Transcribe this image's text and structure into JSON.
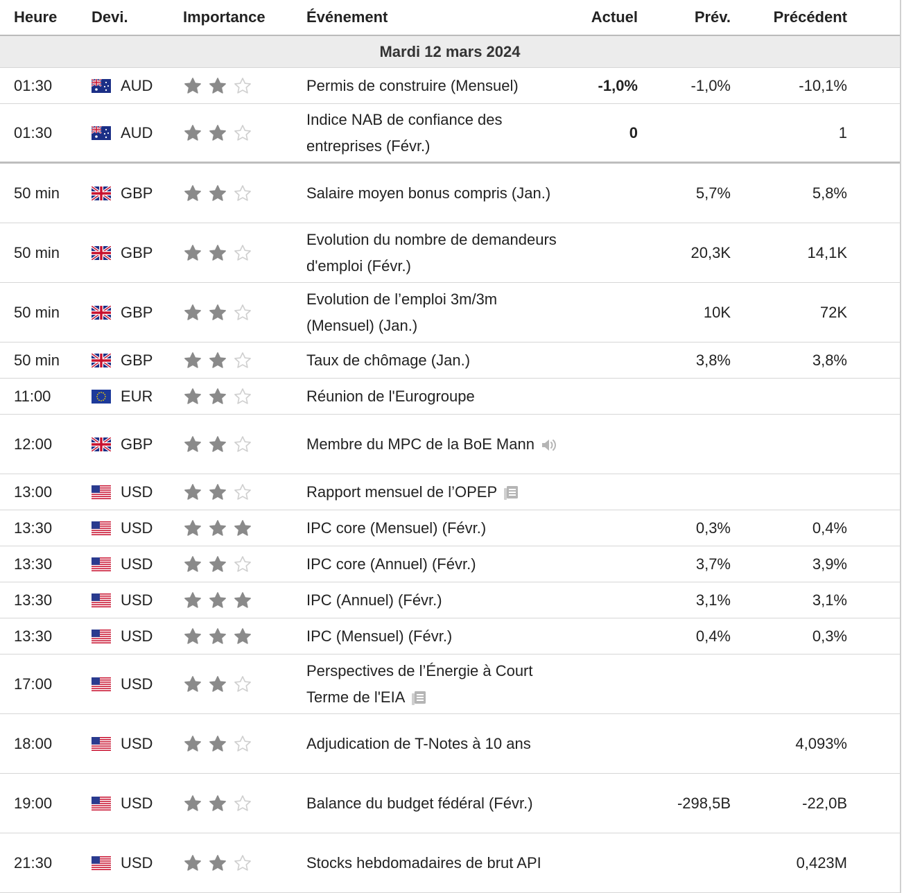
{
  "header": {
    "time": "Heure",
    "currency": "Devi.",
    "importance": "Importance",
    "event": "Événement",
    "actual": "Actuel",
    "forecast": "Prév.",
    "previous": "Précédent"
  },
  "date_label": "Mardi 12 mars 2024",
  "colors": {
    "star_filled": "#8a8a8a",
    "star_empty": "#cfcfcf",
    "header_border": "#bbbbbb",
    "date_bg": "#ececec"
  },
  "rows": [
    {
      "time": "01:30",
      "flag": "AU",
      "currency": "AUD",
      "stars": 2,
      "event": "Permis de construire (Mensuel)",
      "icon": "",
      "actual": "-1,0%",
      "forecast": "-1,0%",
      "previous": "-10,1%"
    },
    {
      "time": "01:30",
      "flag": "AU",
      "currency": "AUD",
      "stars": 2,
      "event": "Indice NAB de confiance des entreprises (Févr.)",
      "icon": "",
      "actual": "0",
      "forecast": "",
      "previous": "1"
    },
    {
      "time": "50 min",
      "flag": "GB",
      "currency": "GBP",
      "stars": 2,
      "event": "Salaire moyen bonus compris (Jan.)",
      "icon": "",
      "actual": "",
      "forecast": "5,7%",
      "previous": "5,8%"
    },
    {
      "time": "50 min",
      "flag": "GB",
      "currency": "GBP",
      "stars": 2,
      "event": "Evolution du nombre de demandeurs d'emploi (Févr.)",
      "icon": "",
      "actual": "",
      "forecast": "20,3K",
      "previous": "14,1K"
    },
    {
      "time": "50 min",
      "flag": "GB",
      "currency": "GBP",
      "stars": 2,
      "event": "Evolution de l’emploi 3m/3m (Mensuel) (Jan.)",
      "icon": "",
      "actual": "",
      "forecast": "10K",
      "previous": "72K"
    },
    {
      "time": "50 min",
      "flag": "GB",
      "currency": "GBP",
      "stars": 2,
      "event": "Taux de chômage (Jan.)",
      "icon": "",
      "actual": "",
      "forecast": "3,8%",
      "previous": "3,8%"
    },
    {
      "time": "11:00",
      "flag": "EU",
      "currency": "EUR",
      "stars": 2,
      "event": "Réunion de l'Eurogroupe",
      "icon": "",
      "actual": "",
      "forecast": "",
      "previous": ""
    },
    {
      "time": "12:00",
      "flag": "GB",
      "currency": "GBP",
      "stars": 2,
      "event": "Membre du MPC de la BoE Mann",
      "icon": "speaker-icon",
      "actual": "",
      "forecast": "",
      "previous": ""
    },
    {
      "time": "13:00",
      "flag": "US",
      "currency": "USD",
      "stars": 2,
      "event": "Rapport mensuel de l’OPEP",
      "icon": "report-icon",
      "actual": "",
      "forecast": "",
      "previous": ""
    },
    {
      "time": "13:30",
      "flag": "US",
      "currency": "USD",
      "stars": 3,
      "event": "IPC core (Mensuel) (Févr.)",
      "icon": "",
      "actual": "",
      "forecast": "0,3%",
      "previous": "0,4%"
    },
    {
      "time": "13:30",
      "flag": "US",
      "currency": "USD",
      "stars": 2,
      "event": "IPC core (Annuel) (Févr.)",
      "icon": "",
      "actual": "",
      "forecast": "3,7%",
      "previous": "3,9%"
    },
    {
      "time": "13:30",
      "flag": "US",
      "currency": "USD",
      "stars": 3,
      "event": "IPC (Annuel) (Févr.)",
      "icon": "",
      "actual": "",
      "forecast": "3,1%",
      "previous": "3,1%"
    },
    {
      "time": "13:30",
      "flag": "US",
      "currency": "USD",
      "stars": 3,
      "event": "IPC (Mensuel) (Févr.)",
      "icon": "",
      "actual": "",
      "forecast": "0,4%",
      "previous": "0,3%"
    },
    {
      "time": "17:00",
      "flag": "US",
      "currency": "USD",
      "stars": 2,
      "event": "Perspectives de l’Énergie à Court Terme de l'EIA",
      "icon": "report-icon",
      "actual": "",
      "forecast": "",
      "previous": ""
    },
    {
      "time": "18:00",
      "flag": "US",
      "currency": "USD",
      "stars": 2,
      "event": "Adjudication de T-Notes à 10 ans",
      "icon": "",
      "actual": "",
      "forecast": "",
      "previous": "4,093%"
    },
    {
      "time": "19:00",
      "flag": "US",
      "currency": "USD",
      "stars": 2,
      "event": "Balance du budget fédéral (Févr.)",
      "icon": "",
      "actual": "",
      "forecast": "-298,5B",
      "previous": "-22,0B"
    },
    {
      "time": "21:30",
      "flag": "US",
      "currency": "USD",
      "stars": 2,
      "event": "Stocks hebdomadaires de brut API",
      "icon": "",
      "actual": "",
      "forecast": "",
      "previous": "0,423M"
    }
  ]
}
